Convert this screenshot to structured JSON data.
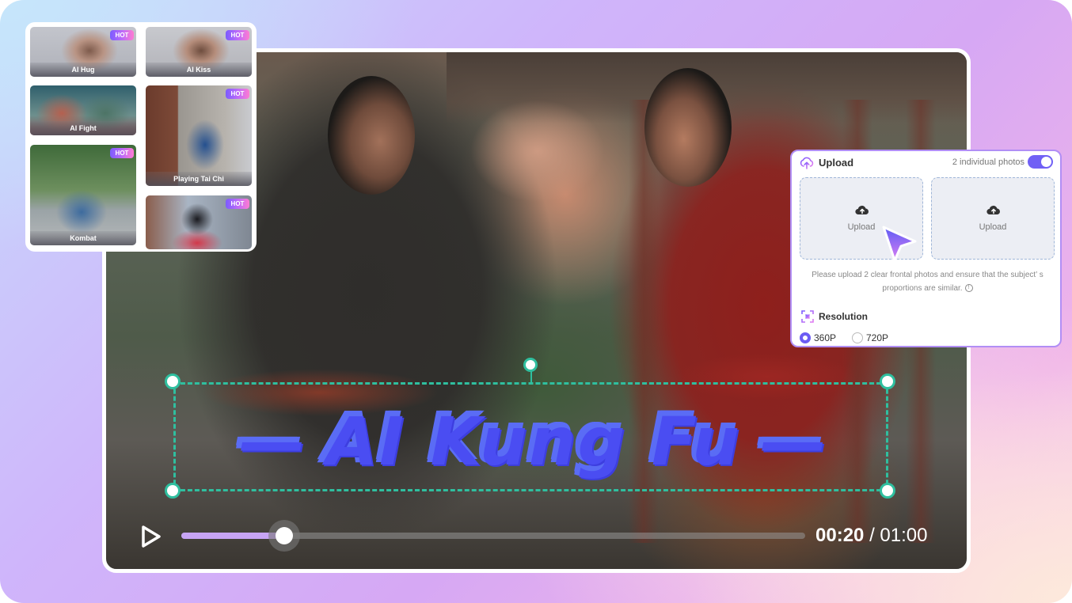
{
  "colors": {
    "accent": "#6c5cf4",
    "selection": "#2fbf9f",
    "progress_fill": "#c7a4f5",
    "panel_border": "#b18ef5",
    "hot_badge_start": "#7b5cff",
    "hot_badge_end": "#ff7bd1"
  },
  "templates": {
    "items": [
      {
        "label": "AI Hug",
        "badge": "HOT"
      },
      {
        "label": "AI Kiss",
        "badge": "HOT"
      },
      {
        "label": "AI Fight",
        "badge": ""
      },
      {
        "label": "Playing Tai Chi",
        "badge": "HOT"
      },
      {
        "label": "Kombat",
        "badge": "HOT"
      },
      {
        "label": "",
        "badge": "HOT"
      }
    ]
  },
  "video": {
    "overlay_title": "— AI Kung Fu —",
    "title_parts": {
      "left_dash": "—",
      "main": "AI Kung Fu",
      "right_dash": "—"
    },
    "current_time": "00:20",
    "separator": "/",
    "total_time": "01:00",
    "progress": 0.165,
    "play_icon": "play-icon"
  },
  "upload_panel": {
    "title": "Upload",
    "photos_toggle_label": "2 individual photos",
    "photos_toggle_on": true,
    "slot1_label": "Upload",
    "slot2_label": "Upload",
    "hint": "Please upload 2 clear frontal photos and ensure that the subject’ s proportions are similar.",
    "hint_icon": "!",
    "resolution_title": "Resolution",
    "resolution_options": [
      "360P",
      "720P"
    ],
    "resolution_selected": "360P"
  }
}
